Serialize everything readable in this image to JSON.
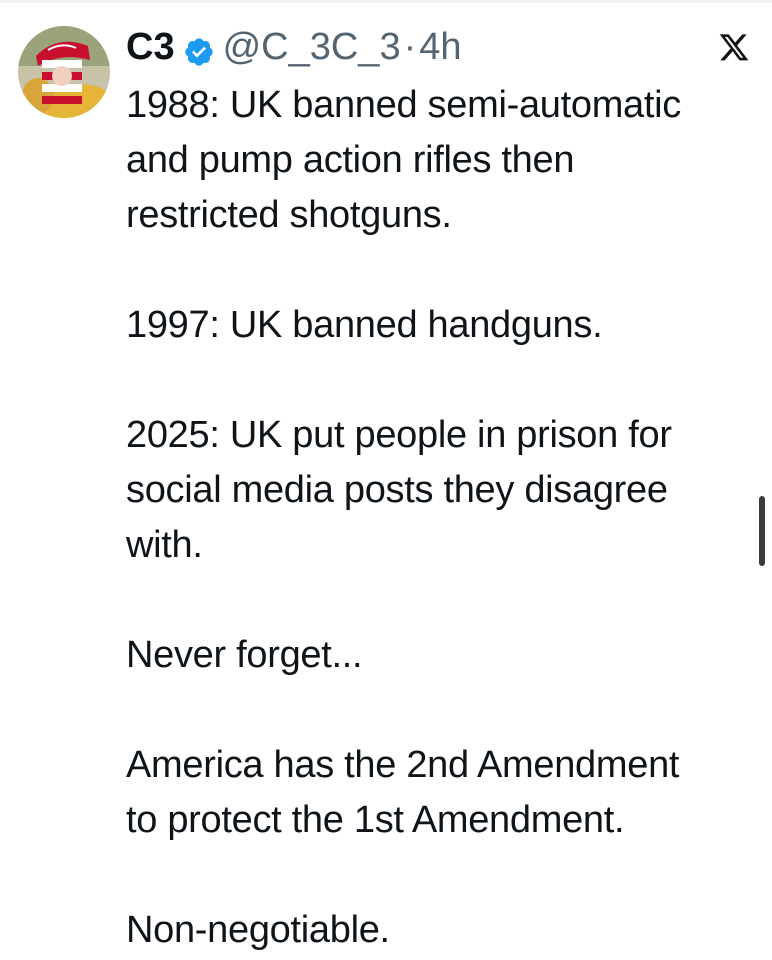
{
  "author": {
    "display_name": "C3",
    "handle": "@C_3C_3",
    "separator": "·",
    "timestamp": "4h",
    "verified_icon": "verified-badge-icon",
    "avatar": "avatar-image"
  },
  "platform": {
    "logo": "x-logo-icon"
  },
  "tweet": {
    "paragraphs": [
      {
        "lines": [
          "1988: UK banned semi-automatic",
          "and pump action rifles then",
          "restricted shotguns."
        ]
      },
      {
        "lines": [
          "1997: UK banned handguns."
        ]
      },
      {
        "lines": [
          "2025: UK put people in prison for",
          "social media posts they disagree",
          "with."
        ]
      },
      {
        "lines": [
          "Never forget..."
        ]
      },
      {
        "lines": [
          "America has the 2nd Amendment",
          "to protect the 1st Amendment."
        ]
      },
      {
        "lines": [
          "Non-negotiable."
        ]
      }
    ]
  },
  "colors": {
    "text": "#0f1419",
    "secondary": "#536471",
    "verified": "#1d9bf0",
    "scrollbar": "#3b3b3b"
  }
}
